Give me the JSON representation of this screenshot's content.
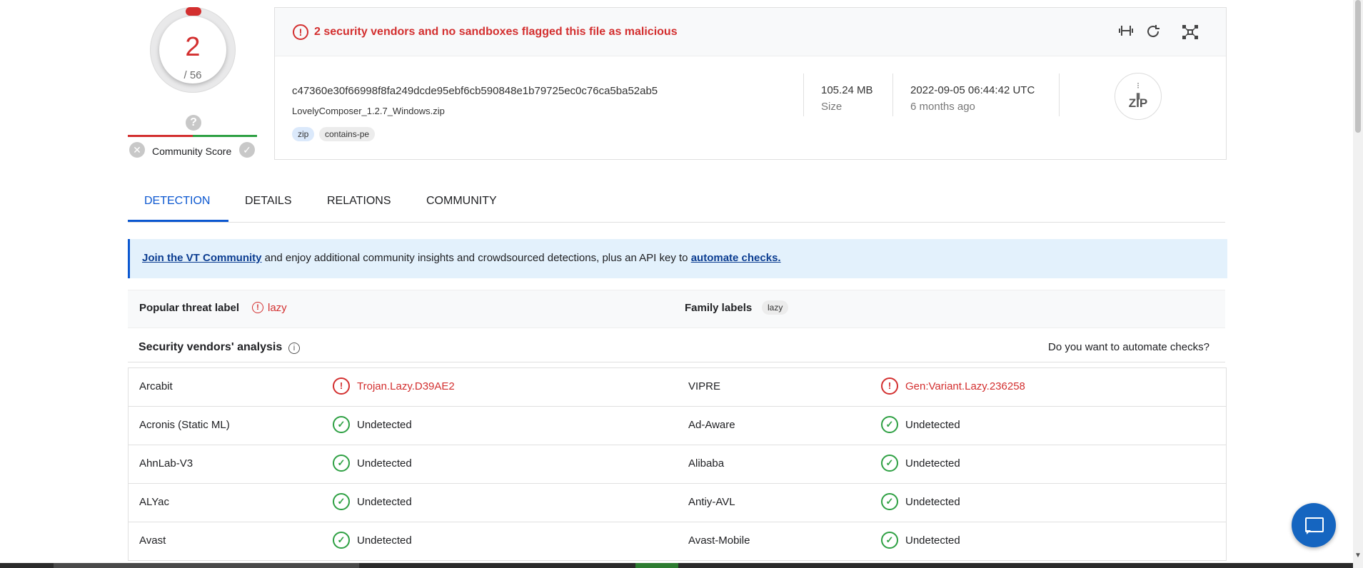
{
  "score": {
    "detections": "2",
    "total": "/ 56"
  },
  "community": {
    "label": "Community Score",
    "question": "?",
    "negative": "✕",
    "positive": "✓"
  },
  "alert": {
    "text": "2 security vendors and no sandboxes flagged this file as malicious",
    "icon": "!"
  },
  "toolbar": {
    "compare_icon": "compare-icon",
    "reanalyze_icon": "reanalyze-icon",
    "graph_icon": "graph-icon"
  },
  "file": {
    "hash": "c47360e30f66998f8fa249dcde95ebf6cb590848e1b79725ec0c76ca5ba52ab5",
    "name": "LovelyComposer_1.2.7_Windows.zip",
    "tags": [
      "zip",
      "contains-pe"
    ],
    "size": "105.24 MB",
    "size_label": "Size",
    "date": "2022-09-05 06:44:42 UTC",
    "date_relative": "6 months ago",
    "type_icon_label": "ZIP"
  },
  "tabs": [
    {
      "label": "DETECTION",
      "active": true
    },
    {
      "label": "DETAILS"
    },
    {
      "label": "RELATIONS"
    },
    {
      "label": "COMMUNITY"
    }
  ],
  "banner": {
    "link1": "Join the VT Community",
    "middle": " and enjoy additional community insights and crowdsourced detections, plus an API key to ",
    "link2": "automate checks."
  },
  "threat": {
    "popular_title": "Popular threat label",
    "popular_value": "lazy",
    "family_title": "Family labels",
    "family_value": "lazy"
  },
  "vendors_header": {
    "title": "Security vendors' analysis",
    "info_icon": "i",
    "right": "Do you want to automate checks?"
  },
  "vendors": [
    {
      "left_name": "Arcabit",
      "left_result": "Trojan.Lazy.D39AE2",
      "left_bad": true,
      "right_name": "VIPRE",
      "right_result": "Gen:Variant.Lazy.236258",
      "right_bad": true
    },
    {
      "left_name": "Acronis (Static ML)",
      "left_result": "Undetected",
      "right_name": "Ad-Aware",
      "right_result": "Undetected"
    },
    {
      "left_name": "AhnLab-V3",
      "left_result": "Undetected",
      "right_name": "Alibaba",
      "right_result": "Undetected"
    },
    {
      "left_name": "ALYac",
      "left_result": "Undetected",
      "right_name": "Antiy-AVL",
      "right_result": "Undetected"
    },
    {
      "left_name": "Avast",
      "left_result": "Undetected",
      "right_name": "Avast-Mobile",
      "right_result": "Undetected"
    }
  ],
  "colors": {
    "malicious": "#d32f2f",
    "clean": "#2ea043",
    "accent": "#0b57d0"
  }
}
